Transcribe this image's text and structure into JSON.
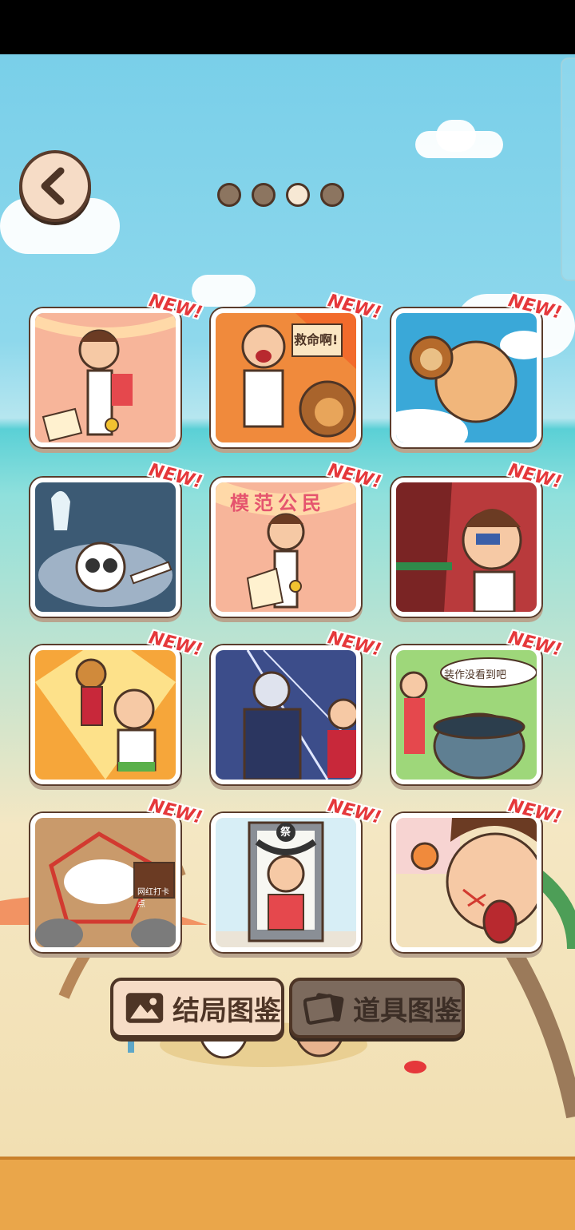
{
  "header": {
    "back_icon": "chevron-left-icon",
    "pagination": {
      "pages": 4,
      "current": 3
    }
  },
  "gallery": {
    "badge_text": "NEW!",
    "cards": [
      {
        "name": "ending-card-1",
        "caption": ""
      },
      {
        "name": "ending-card-2",
        "caption": "救命啊!"
      },
      {
        "name": "ending-card-3",
        "caption": ""
      },
      {
        "name": "ending-card-4",
        "caption": ""
      },
      {
        "name": "ending-card-5",
        "caption": "模范公民"
      },
      {
        "name": "ending-card-6",
        "caption": ""
      },
      {
        "name": "ending-card-7",
        "caption": ""
      },
      {
        "name": "ending-card-8",
        "caption": ""
      },
      {
        "name": "ending-card-9",
        "caption": "装作没看到吧"
      },
      {
        "name": "ending-card-10",
        "caption": "网红打卡点"
      },
      {
        "name": "ending-card-11",
        "caption": "祭"
      },
      {
        "name": "ending-card-12",
        "caption": ""
      }
    ]
  },
  "tabs": {
    "endings_label": "结局图鉴",
    "endings_icon": "picture-icon",
    "items_label": "道具图鉴",
    "items_icon": "cards-icon"
  },
  "colors": {
    "outline": "#4e3526",
    "badge": "#e5383b",
    "sky": "#79cfe9",
    "sand": "#f2dfb2",
    "footer": "#eaa64a"
  }
}
